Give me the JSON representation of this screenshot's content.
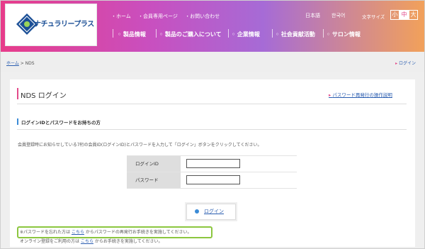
{
  "header": {
    "logo_text": "ナチュラリープラス",
    "top_links": [
      "・ホーム",
      "・会員専用ページ",
      "・お問い合わせ"
    ],
    "lang_ja": "日本語",
    "lang_ko": "한국어",
    "font_size_label": "文字サイズ",
    "font_sizes": [
      "小",
      "中",
      "大"
    ],
    "nav": [
      "製品情報",
      "製品のご購入について",
      "企業情報",
      "社会貢献活動",
      "サロン情報"
    ]
  },
  "breadcrumb": {
    "home": "ホーム",
    "sep": " > ",
    "current": "NDS"
  },
  "top_login": "ログイン",
  "page": {
    "title": "NDS ログイン",
    "reissue_link": "パスワード再発行の操作説明",
    "section_title": "ログインIDとパスワードをお持ちの方",
    "intro": "会員登録時にお知らせしている7桁の会員ID(ログインID)とパスワードを入力して「ログイン」ボタンをクリックしてください。"
  },
  "form": {
    "id_label": "ログインID",
    "password_label": "パスワード",
    "login_button": "ログイン"
  },
  "notes": {
    "forgot_prefix": "※パスワードを忘れた方は",
    "forgot_link": "こちら",
    "forgot_suffix": "からパスワードの再発行お手続きを実施してください。",
    "online_prefix": "オンライン登録をご利用の方は",
    "online_link": "こちら",
    "online_suffix": "からお手続きを実施してください。"
  },
  "colors": {
    "accent": "#e24a8a",
    "link": "#2a5db0",
    "highlight": "#8cc63f"
  }
}
